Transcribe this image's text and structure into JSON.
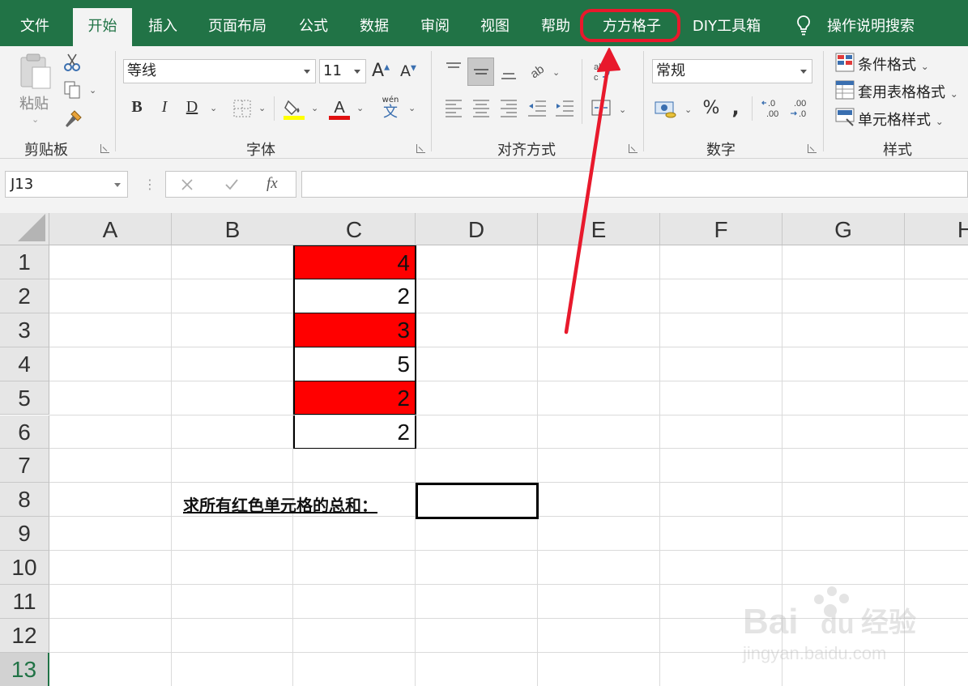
{
  "tabs": [
    {
      "label": "文件",
      "active": false
    },
    {
      "label": "开始",
      "active": true
    },
    {
      "label": "插入",
      "active": false
    },
    {
      "label": "页面布局",
      "active": false
    },
    {
      "label": "公式",
      "active": false
    },
    {
      "label": "数据",
      "active": false
    },
    {
      "label": "审阅",
      "active": false
    },
    {
      "label": "视图",
      "active": false
    },
    {
      "label": "帮助",
      "active": false
    },
    {
      "label": "方方格子",
      "active": false,
      "highlighted": true
    },
    {
      "label": "DIY工具箱",
      "active": false
    },
    {
      "label": "操作说明搜索",
      "active": false,
      "icon": "lightbulb-icon"
    }
  ],
  "ribbon": {
    "clipboard": {
      "label": "剪贴板",
      "paste_label": "粘贴"
    },
    "font": {
      "label": "字体",
      "font_name": "等线",
      "font_size": "11",
      "phonetic_top": "wén",
      "phonetic_bottom": "文"
    },
    "alignment": {
      "label": "对齐方式"
    },
    "number": {
      "label": "数字",
      "format": "常规",
      "decimals_increase": ".0\n.00",
      "decimals_decrease": ".00\n→.0"
    },
    "styles": {
      "label": "样式",
      "conditional_format": "条件格式",
      "table_format": "套用表格格式",
      "cell_styles": "单元格样式"
    }
  },
  "formula_bar": {
    "name_box": "J13",
    "fx": "fx",
    "formula": ""
  },
  "columns": [
    "A",
    "B",
    "C",
    "D",
    "E",
    "F",
    "G",
    "H"
  ],
  "rows": [
    "1",
    "2",
    "3",
    "4",
    "5",
    "6",
    "7",
    "8",
    "9",
    "10",
    "11",
    "12",
    "13"
  ],
  "selected_row": "13",
  "cells": {
    "column_c": [
      {
        "row": "1",
        "value": "4",
        "fill": "red"
      },
      {
        "row": "2",
        "value": "2",
        "fill": "none"
      },
      {
        "row": "3",
        "value": "3",
        "fill": "red"
      },
      {
        "row": "4",
        "value": "5",
        "fill": "none"
      },
      {
        "row": "5",
        "value": "2",
        "fill": "red"
      },
      {
        "row": "6",
        "value": "2",
        "fill": "none"
      }
    ],
    "prompt": "求所有红色单元格的总和：",
    "answer": ""
  },
  "colors": {
    "ribbon_green": "#217346",
    "highlight_red": "#e8192c",
    "cell_red": "#ff0000"
  },
  "watermark": {
    "brand": "Bai",
    "brand_du": "du",
    "jingyan": "经验",
    "url": "jingyan.baidu.com"
  }
}
